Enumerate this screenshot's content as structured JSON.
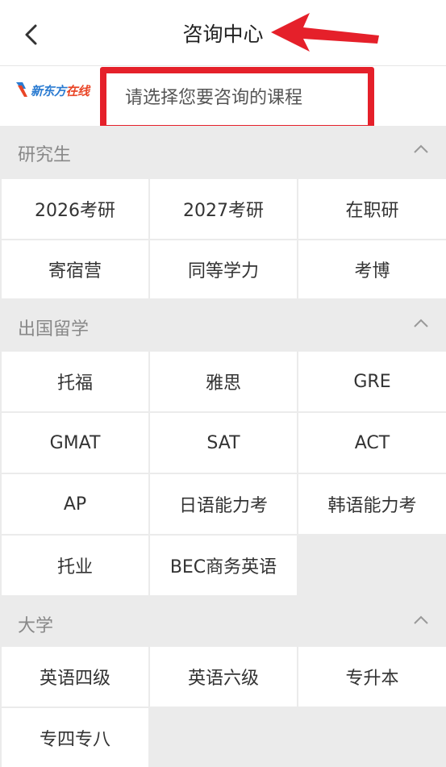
{
  "header": {
    "title": "咨询中心",
    "back_icon": "chevron-left-icon",
    "annotation_arrow_color": "#e5202a"
  },
  "brand": {
    "logo_text_a": "新东方",
    "logo_text_b": "在线",
    "brand_color": "#2a7bd1",
    "accent_color": "#e94526"
  },
  "course_select": {
    "placeholder": "请选择您要咨询的课程",
    "highlight_color": "#e5202a"
  },
  "sections": [
    {
      "name": "研究生",
      "collapse_icon": "chevron-up-icon",
      "items": [
        "2026考研",
        "2027考研",
        "在职研",
        "寄宿营",
        "同等学力",
        "考博"
      ]
    },
    {
      "name": "出国留学",
      "collapse_icon": "chevron-up-icon",
      "items": [
        "托福",
        "雅思",
        "GRE",
        "GMAT",
        "SAT",
        "ACT",
        "AP",
        "日语能力考",
        "韩语能力考",
        "托业",
        "BEC商务英语"
      ]
    },
    {
      "name": "大学",
      "collapse_icon": "chevron-up-icon",
      "items": [
        "英语四级",
        "英语六级",
        "专升本",
        "专四专八"
      ]
    }
  ]
}
